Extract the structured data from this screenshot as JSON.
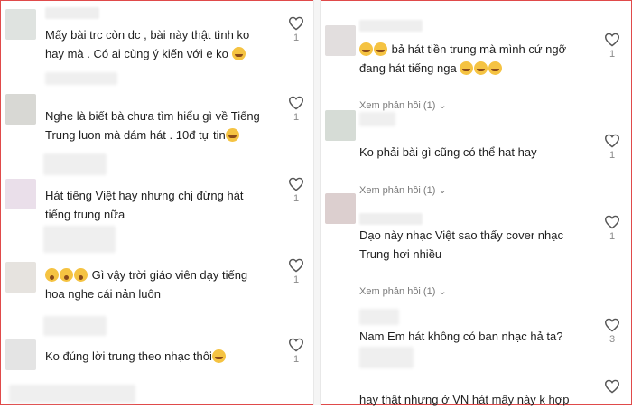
{
  "left": [
    {
      "text": "Mấy bài trc còn dc , bài này thật tình ko\nhay mà . Có ai cùng ý kiến với e ko",
      "emoji": "laugh",
      "likes": "1"
    },
    {
      "text": "Nghe là biết bà chưa tìm hiểu gì về Tiếng\nTrung luon mà dám hát . 10đ tự tin",
      "emoji": "laugh",
      "likes": "1"
    },
    {
      "text": "Hát tiếng Việt hay nhưng chị đừng hát\ntiếng trung nữa",
      "likes": "1"
    },
    {
      "text": " Gì vậy trời giáo viên dạy tiếng\nhoa nghe cái nản luôn",
      "emoji_prefix": "flushed x3",
      "likes": "1"
    },
    {
      "text": "Ko đúng lời trung theo nhạc thôi",
      "emoji": "laugh",
      "likes": "1"
    }
  ],
  "right": [
    {
      "username": "...",
      "text": " bả hát tiền trung mà mình cứ ngỡ\nđang hát tiếng nga",
      "emoji_prefix": "laugh x2",
      "emoji": "laugh x3",
      "likes": "1",
      "replies": "Xem phản hồi (1)"
    },
    {
      "text": "Ko phải bài gì cũng có thể hat hay",
      "likes": "1",
      "replies": "Xem phản hồi (1)"
    },
    {
      "text": "Dạo này nhạc Việt sao thấy cover nhạc\nTrung hơi nhiều",
      "likes": "1",
      "replies": "Xem phản hồi (1)"
    },
    {
      "text": "Nam Em hát không có ban nhạc hả ta?",
      "likes": "3"
    },
    {
      "text": "hay thật nhưng ở VN hát mấy này k hợp",
      "likes": ""
    }
  ],
  "icons": {
    "like": "heart-outline-icon",
    "replies": "chevron-down-icon"
  }
}
